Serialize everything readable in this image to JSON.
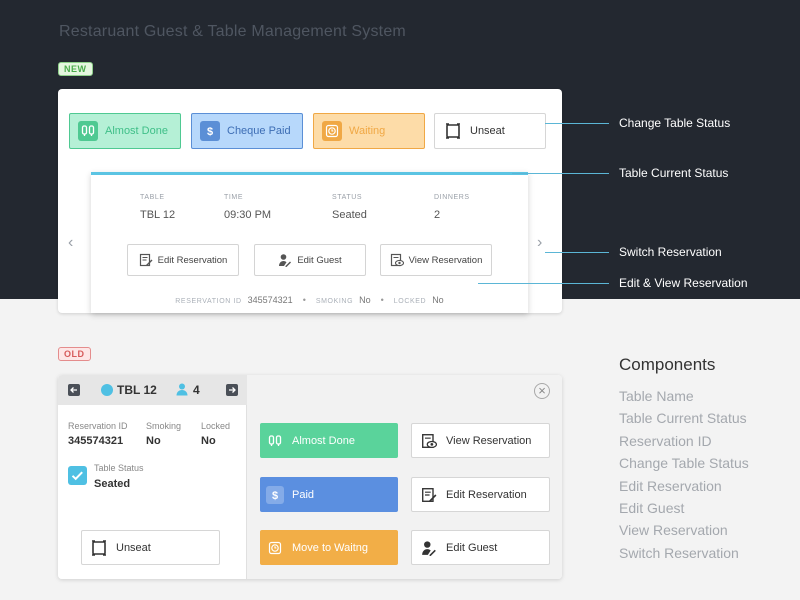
{
  "page": {
    "title": "Restaruant Guest & Table Management System"
  },
  "tags": {
    "new": "NEW",
    "old": "OLD"
  },
  "new_card": {
    "status_buttons": [
      {
        "label": "Almost Done",
        "icon": "buzzer-icon"
      },
      {
        "label": "Cheque Paid",
        "icon": "dollar-icon"
      },
      {
        "label": "Waiting",
        "icon": "clock-icon"
      },
      {
        "label": "Unseat",
        "icon": "frame-icon"
      }
    ],
    "reservation": {
      "columns": [
        {
          "label": "TABLE",
          "value": "TBL 12"
        },
        {
          "label": "TIME",
          "value": "09:30 PM"
        },
        {
          "label": "STATUS",
          "value": "Seated"
        },
        {
          "label": "DINNERS",
          "value": "2"
        }
      ],
      "actions": [
        {
          "label": "Edit Reservation",
          "icon": "edit-document-icon"
        },
        {
          "label": "Edit Guest",
          "icon": "edit-guest-icon"
        },
        {
          "label": "View Reservation",
          "icon": "view-document-icon"
        }
      ],
      "footer": {
        "reservation_id_label": "RESERVATION ID",
        "reservation_id": "345574321",
        "smoking_label": "SMOKING",
        "smoking": "No",
        "locked_label": "LOCKED",
        "locked": "No",
        "separator": "•"
      }
    },
    "arrows": {
      "left": "‹",
      "right": "›"
    }
  },
  "callouts": {
    "change_status": "Change Table Status",
    "current_status": "Table Current Status",
    "switch": "Switch Reservation",
    "edit_view": "Edit & View Reservation"
  },
  "old_card": {
    "header": {
      "table": "TBL 12",
      "guests": "4"
    },
    "fields": {
      "reservation_id_label": "Reservation ID",
      "reservation_id": "345574321",
      "smoking_label": "Smoking",
      "smoking": "No",
      "locked_label": "Locked",
      "locked": "No",
      "status_label": "Table Status",
      "status": "Seated"
    },
    "unseat": "Unseat",
    "buttons": {
      "almost_done": "Almost Done",
      "paid": "Paid",
      "waiting": "Move to Waitng",
      "view_reservation": "View Reservation",
      "edit_reservation": "Edit Reservation",
      "edit_guest": "Edit Guest"
    },
    "close": "×"
  },
  "components": {
    "title": "Components",
    "items": [
      "Table Name",
      "Table Current Status",
      "Reservation ID",
      "Change Table Status",
      "Edit Reservation",
      "Edit Guest",
      "View Reservation",
      "Switch Reservation"
    ]
  },
  "colors": {
    "dark_band": "#232830",
    "accent": "#5bc4e3",
    "green": "#4fc992",
    "blue": "#5b8fd6",
    "orange": "#f0a845"
  }
}
